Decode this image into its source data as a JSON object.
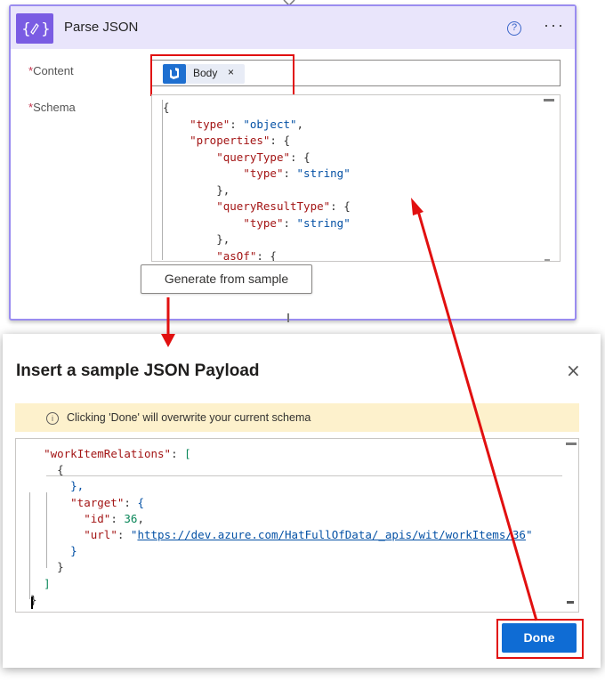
{
  "action_card": {
    "title": "Parse JSON",
    "icon": "parse-json-icon",
    "help_glyph": "?",
    "more_glyph": "···",
    "content": {
      "label": "Content",
      "required_mark": "*",
      "token": {
        "label": "Body",
        "close_glyph": "×",
        "icon": "devops-icon"
      }
    },
    "schema": {
      "label": "Schema",
      "required_mark": "*"
    },
    "generate_button_label": "Generate from sample"
  },
  "dialog": {
    "title": "Insert a sample JSON Payload",
    "close_glyph": "×",
    "warning": {
      "icon_glyph": "i",
      "text": "Clicking 'Done' will overwrite your current schema"
    },
    "done_button_label": "Done"
  },
  "colors": {
    "accent": "#7a5ce3",
    "card_border": "#9a8cf0",
    "header_bg": "#e9e5fb",
    "primary_button": "#0f6cd4",
    "annotation_red": "#e11010",
    "warning_bg": "#fdf1cc"
  }
}
